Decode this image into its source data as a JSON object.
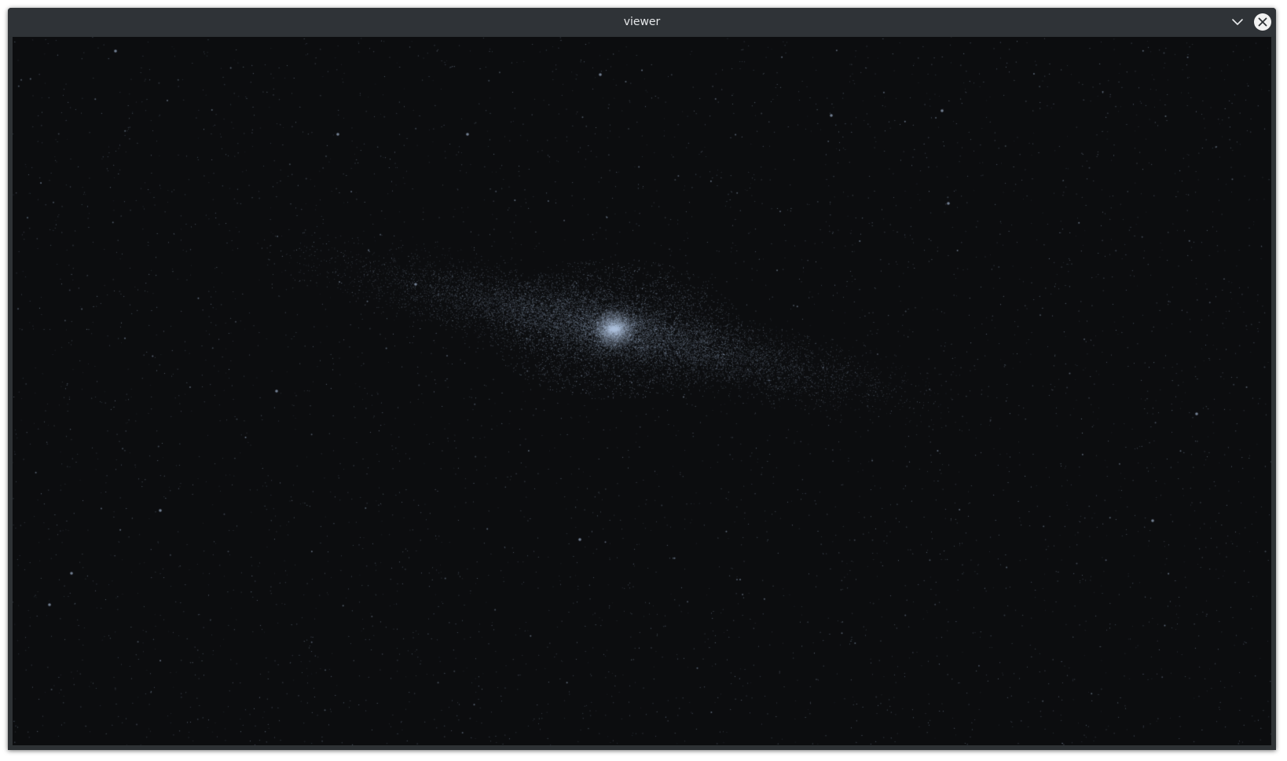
{
  "window": {
    "title": "viewer"
  },
  "controls": {
    "minimize_icon": "chevron-down-icon",
    "close_icon": "close-icon"
  },
  "scene": {
    "background_color": "#0c0d0f",
    "star_color": "#9fb2cc",
    "core_color": "#bcd0ec"
  }
}
